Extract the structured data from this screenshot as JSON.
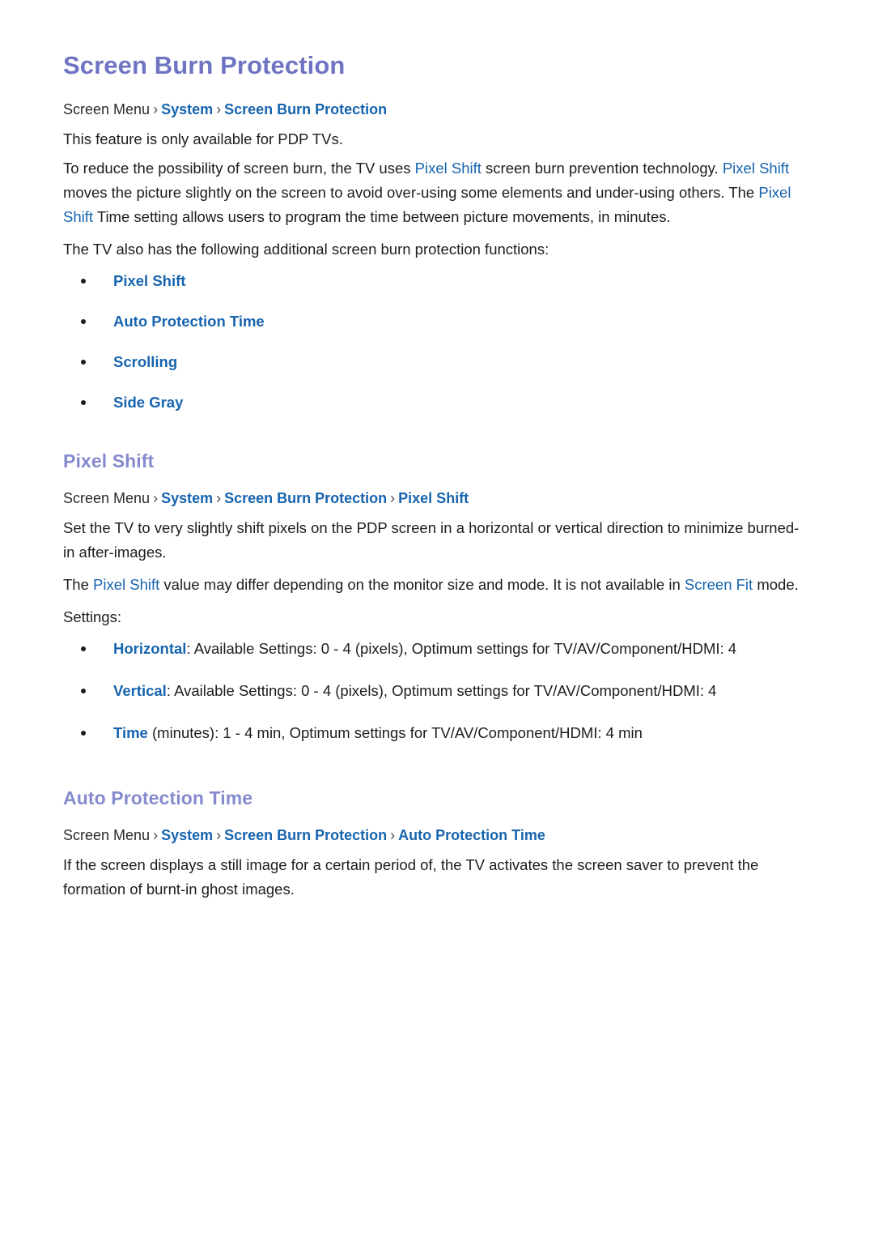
{
  "document": {
    "title": "Screen Burn Protection"
  },
  "intro": {
    "breadcrumb": {
      "root": "Screen Menu",
      "sep": "›",
      "links": [
        "System",
        "Screen Burn Protection"
      ]
    },
    "availability_note": "This feature is only available for PDP TVs.",
    "paragraph_segments": [
      {
        "text": "To reduce the possibility of screen burn, the TV uses ",
        "highlight": false
      },
      {
        "text": "Pixel Shift",
        "highlight": true
      },
      {
        "text": " screen burn prevention technology. ",
        "highlight": false
      },
      {
        "text": "Pixel Shift",
        "highlight": true
      },
      {
        "text": " moves the picture slightly on the screen to avoid over-using some elements and under-using others. The ",
        "highlight": false
      },
      {
        "text": "Pixel Shift",
        "highlight": true
      },
      {
        "text": " Time setting allows users to program the time between picture movements, in minutes.",
        "highlight": false
      }
    ],
    "functions_lead": "The TV also has the following additional screen burn protection functions:",
    "functions": [
      "Pixel Shift",
      "Auto Protection Time",
      "Scrolling",
      "Side Gray"
    ]
  },
  "pixel_shift": {
    "heading": "Pixel Shift",
    "breadcrumb": {
      "root": "Screen Menu",
      "sep": "›",
      "links": [
        "System",
        "Screen Burn Protection",
        "Pixel Shift"
      ]
    },
    "description": "Set the TV to very slightly shift pixels on the PDP screen in a horizontal or vertical direction to minimize burned-in after-images.",
    "note_segments": [
      {
        "text": "The ",
        "highlight": false
      },
      {
        "text": "Pixel Shift",
        "highlight": true
      },
      {
        "text": " value may differ depending on the monitor size and mode. It is not available in ",
        "highlight": false
      },
      {
        "text": "Screen Fit",
        "highlight": true
      },
      {
        "text": " mode.",
        "highlight": false
      }
    ],
    "settings_label": "Settings:",
    "settings": [
      {
        "name": "Horizontal",
        "detail": ": Available Settings: 0 - 4 (pixels), Optimum settings for TV/AV/Component/HDMI: 4"
      },
      {
        "name": "Vertical",
        "detail": ": Available Settings: 0 - 4 (pixels), Optimum settings for TV/AV/Component/HDMI: 4"
      },
      {
        "name": "Time",
        "detail": " (minutes): 1 - 4 min, Optimum settings for TV/AV/Component/HDMI: 4 min"
      }
    ]
  },
  "auto_protection_time": {
    "heading": "Auto Protection Time",
    "breadcrumb": {
      "root": "Screen Menu",
      "sep": "›",
      "links": [
        "System",
        "Screen Burn Protection",
        "Auto Protection Time"
      ]
    },
    "description": "If the screen displays a still image for a certain period of, the TV activates the screen saver to prevent the formation of burnt-in ghost images."
  },
  "colors": {
    "title_purple": "#6E74C2",
    "section_purple": "#858BCD",
    "link_blue": "#1764AF",
    "body_text": "#1d1d1d",
    "background": "#ffffff"
  }
}
